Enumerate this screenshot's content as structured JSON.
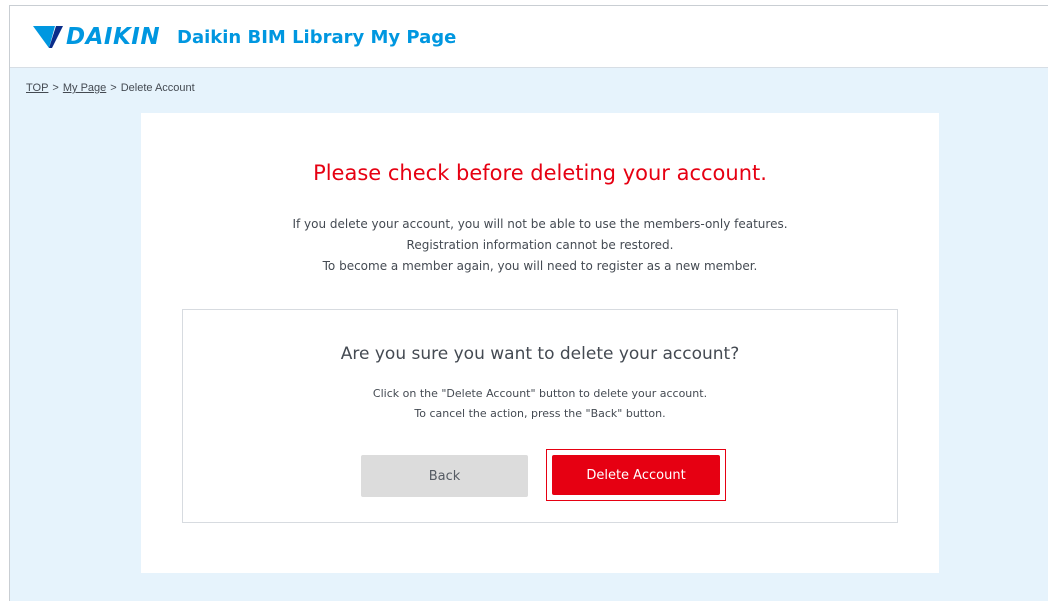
{
  "header": {
    "logo_text": "DAIKIN",
    "title": "Daikin BIM Library My Page",
    "brand_color": "#0097e0"
  },
  "breadcrumb": {
    "items": [
      {
        "label": "TOP",
        "link": true
      },
      {
        "label": "My Page",
        "link": true
      },
      {
        "label": "Delete Account",
        "link": false
      }
    ],
    "separator": ">"
  },
  "main": {
    "title": "Please check before deleting your account.",
    "title_color": "#e60012",
    "info_lines": [
      "If you delete your account, you will not be able to use the members-only features.",
      "Registration information cannot be restored.",
      "To become a member again, you will need to register as a new member."
    ]
  },
  "confirm": {
    "title": "Are you sure you want to delete your account?",
    "lines": [
      "Click on the \"Delete Account\" button to delete your account.",
      "To cancel the action, press the \"Back\" button."
    ],
    "back_label": "Back",
    "delete_label": "Delete Account",
    "delete_color": "#e60012"
  },
  "icons": {
    "logo_mark": "daikin-logo-icon"
  }
}
